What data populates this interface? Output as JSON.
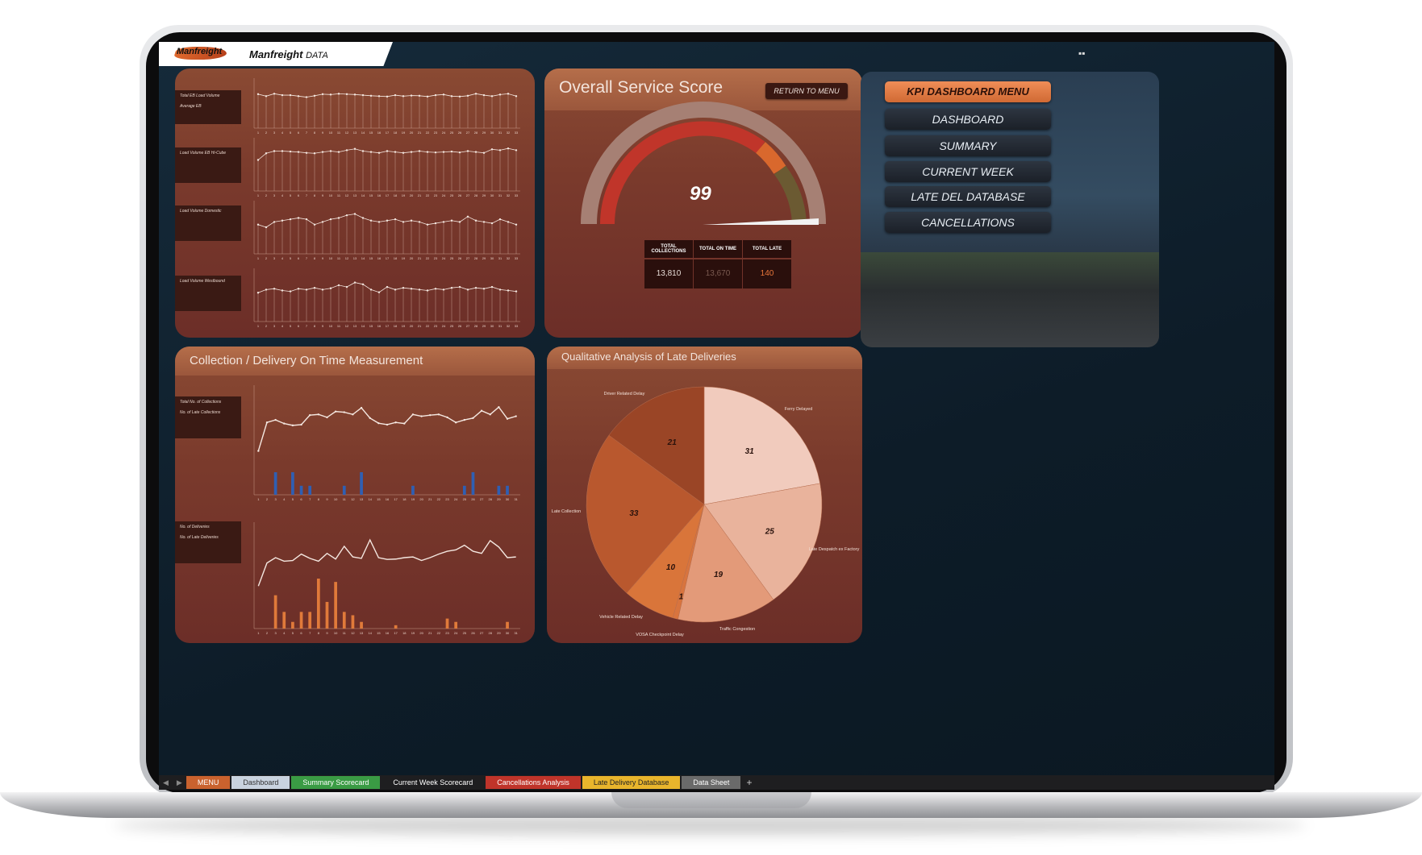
{
  "app": {
    "logo_text": "Manfreight",
    "brand_name": "Manfreight",
    "brand_sub": "DATA"
  },
  "panels": {
    "service": {
      "title": "Overall Service Score",
      "return_button": "RETURN TO MENU",
      "score": "99",
      "stats": [
        {
          "label": "TOTAL COLLECTIONS",
          "value": "13,810"
        },
        {
          "label": "TOTAL ON TIME",
          "value": "13,670"
        },
        {
          "label": "TOTAL LATE",
          "value": "140"
        }
      ]
    },
    "collection": {
      "title": "Collection / Delivery On Time Measurement"
    },
    "qualitative": {
      "title": "Qualitative Analysis of Late Deliveries"
    }
  },
  "menu": {
    "items": [
      {
        "label": "KPI DASHBOARD MENU",
        "active": true
      },
      {
        "label": "DASHBOARD"
      },
      {
        "label": "SUMMARY"
      },
      {
        "label": "CURRENT WEEK"
      },
      {
        "label": "LATE DEL DATABASE"
      },
      {
        "label": "CANCELLATIONS"
      }
    ]
  },
  "legends": {
    "load1": [
      "Total EB Load Volume",
      "Average EB"
    ],
    "load2": [
      "Load Volume EB Hi-Cube"
    ],
    "load3": [
      "Load Volume Domestic"
    ],
    "load4": [
      "Load Volume Westbound"
    ],
    "coll": [
      "Total No. of Collections",
      "No. of Late Collections"
    ],
    "del": [
      "No. of Deliveries",
      "No. of Late Deliveries"
    ]
  },
  "tabs": [
    {
      "label": "MENU",
      "color": "#c9622e"
    },
    {
      "label": "Dashboard",
      "color": "#c9d3df",
      "text": "#333"
    },
    {
      "label": "Summary Scorecard",
      "color": "#3a9b44"
    },
    {
      "label": "Current Week Scorecard",
      "color": "#1e1e20"
    },
    {
      "label": "Cancellations Analysis",
      "color": "#c0342a"
    },
    {
      "label": "Late Delivery Database",
      "color": "#e9b52c",
      "text": "#222"
    },
    {
      "label": "Data Sheet",
      "color": "#6a6a6a"
    }
  ],
  "chart_data": [
    {
      "type": "line",
      "title": "",
      "x": [
        1,
        2,
        3,
        4,
        5,
        6,
        7,
        8,
        9,
        10,
        11,
        12,
        13,
        14,
        15,
        16,
        17,
        18,
        19,
        20,
        21,
        22,
        23,
        24,
        25,
        26,
        27,
        28,
        29,
        30,
        31,
        32,
        33
      ],
      "series": [
        {
          "name": "Total EB Load Volume",
          "values": [
            170,
            160,
            172,
            165,
            165,
            160,
            155,
            162,
            170,
            168,
            172,
            170,
            168,
            165,
            162,
            160,
            158,
            165,
            160,
            163,
            162,
            158,
            165,
            168,
            160,
            158,
            162,
            172,
            165,
            160,
            168,
            172,
            160
          ]
        }
      ],
      "ylim": [
        0,
        250
      ]
    },
    {
      "type": "line",
      "title": "",
      "x": [
        1,
        2,
        3,
        4,
        5,
        6,
        7,
        8,
        9,
        10,
        11,
        12,
        13,
        14,
        15,
        16,
        17,
        18,
        19,
        20,
        21,
        22,
        23,
        24,
        25,
        26,
        27,
        28,
        29,
        30,
        31,
        32,
        33
      ],
      "series": [
        {
          "name": "Load Volume EB Hi-Cube",
          "values": [
            70,
            85,
            90,
            90,
            89,
            88,
            86,
            85,
            88,
            90,
            88,
            92,
            95,
            90,
            88,
            86,
            90,
            88,
            86,
            88,
            90,
            88,
            87,
            88,
            89,
            87,
            90,
            88,
            86,
            94,
            92,
            96,
            92
          ]
        }
      ],
      "ylim": [
        0,
        120
      ]
    },
    {
      "type": "line",
      "title": "",
      "x": [
        1,
        2,
        3,
        4,
        5,
        6,
        7,
        8,
        9,
        10,
        11,
        12,
        13,
        14,
        15,
        16,
        17,
        18,
        19,
        20,
        21,
        22,
        23,
        24,
        25,
        26,
        27,
        28,
        29,
        30,
        31,
        32,
        33
      ],
      "series": [
        {
          "name": "Load Volume Domestic",
          "values": [
            22,
            20,
            24,
            25,
            26,
            27,
            26,
            22,
            24,
            26,
            27,
            29,
            30,
            27,
            25,
            24,
            25,
            26,
            24,
            25,
            24,
            22,
            23,
            24,
            25,
            24,
            28,
            25,
            24,
            23,
            26,
            24,
            22
          ]
        }
      ],
      "ylim": [
        0,
        40
      ]
    },
    {
      "type": "line",
      "title": "",
      "x": [
        1,
        2,
        3,
        4,
        5,
        6,
        7,
        8,
        9,
        10,
        11,
        12,
        13,
        14,
        15,
        16,
        17,
        18,
        19,
        20,
        21,
        22,
        23,
        24,
        25,
        26,
        27,
        28,
        29,
        30,
        31,
        32,
        33
      ],
      "series": [
        {
          "name": "Load Volume Westbound",
          "values": [
            65,
            72,
            74,
            70,
            68,
            74,
            72,
            76,
            72,
            75,
            82,
            78,
            88,
            84,
            72,
            66,
            78,
            72,
            76,
            74,
            72,
            70,
            74,
            72,
            76,
            78,
            72,
            76,
            74,
            78,
            72,
            70,
            68
          ]
        }
      ],
      "ylim": [
        0,
        120
      ]
    },
    {
      "type": "line",
      "title": "",
      "x": [
        1,
        2,
        3,
        4,
        5,
        6,
        7,
        8,
        9,
        10,
        11,
        12,
        13,
        14,
        15,
        16,
        17,
        18,
        19,
        20,
        21,
        22,
        23,
        24,
        25,
        26,
        27,
        28,
        29,
        30,
        31
      ],
      "series": [
        {
          "name": "Total No. of Collections",
          "values": [
            120,
            198,
            205,
            195,
            190,
            192,
            218,
            220,
            212,
            228,
            226,
            220,
            238,
            210,
            196,
            192,
            198,
            195,
            220,
            215,
            218,
            220,
            212,
            198,
            205,
            210,
            230,
            220,
            240,
            208,
            215
          ]
        },
        {
          "name": "No. of Late Collections",
          "values": [
            0,
            0,
            5,
            0,
            5,
            2,
            2,
            0,
            0,
            0,
            2,
            0,
            5,
            0,
            0,
            0,
            0,
            0,
            2,
            0,
            0,
            0,
            0,
            0,
            2,
            5,
            0,
            0,
            2,
            2,
            0
          ]
        }
      ],
      "ylim": [
        0,
        300
      ]
    },
    {
      "type": "line",
      "title": "",
      "x": [
        1,
        2,
        3,
        4,
        5,
        6,
        7,
        8,
        9,
        10,
        11,
        12,
        13,
        14,
        15,
        16,
        17,
        18,
        19,
        20,
        21,
        22,
        23,
        24,
        25,
        26,
        27,
        28,
        29,
        30,
        31
      ],
      "series": [
        {
          "name": "No. of Deliveries",
          "values": [
            120,
            185,
            200,
            190,
            192,
            210,
            198,
            190,
            212,
            196,
            232,
            202,
            198,
            250,
            200,
            195,
            196,
            200,
            202,
            192,
            200,
            210,
            218,
            222,
            235,
            218,
            212,
            248,
            230,
            200,
            202
          ]
        },
        {
          "name": "No. of Late Deliveries",
          "values": [
            0,
            0,
            10,
            5,
            2,
            5,
            5,
            15,
            8,
            14,
            5,
            4,
            2,
            0,
            0,
            0,
            1,
            0,
            0,
            0,
            0,
            0,
            3,
            2,
            0,
            0,
            0,
            0,
            0,
            2,
            0
          ]
        }
      ],
      "ylim": [
        0,
        300
      ]
    },
    {
      "type": "pie",
      "title": "Qualitative Analysis of Late Deliveries",
      "categories": [
        "Ferry Delayed",
        "Late Despatch ex Factory",
        "Traffic Congestion",
        "VOSA Checkpoint Delay",
        "Vehicle Related Delay",
        "Late Collection",
        "Driver Related Delay"
      ],
      "values": [
        31,
        25,
        19,
        1,
        10,
        33,
        21
      ]
    }
  ]
}
